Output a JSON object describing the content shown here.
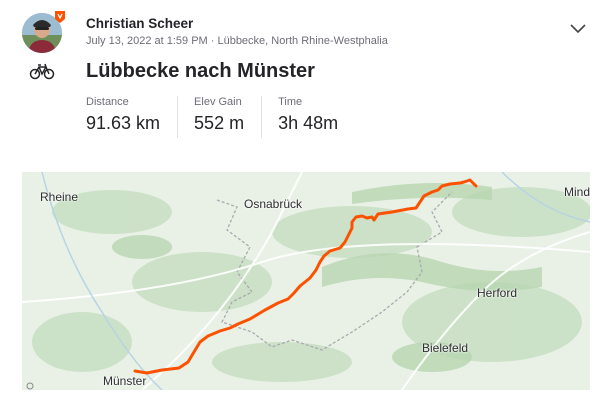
{
  "athlete": {
    "name": "Christian Scheer",
    "meta": "July 13, 2022 at 1:59 PM · Lübbecke, North Rhine-Westphalia"
  },
  "activity": {
    "sport_icon": "bike-icon",
    "title": "Lübbecke nach Münster",
    "stats": [
      {
        "label": "Distance",
        "value": "91.63 km"
      },
      {
        "label": "Elev Gain",
        "value": "552 m"
      },
      {
        "label": "Time",
        "value": "3h 48m"
      }
    ]
  },
  "map": {
    "cities": {
      "rheine": "Rheine",
      "osnabrueck": "Osnabrück",
      "minden": "Mind",
      "herford": "Herford",
      "bielefeld": "Bielefeld",
      "muenster": "Münster"
    },
    "route_color": "#fc5200"
  },
  "colors": {
    "accent": "#fc5200",
    "text": "#242428",
    "muted": "#6d6d78"
  }
}
